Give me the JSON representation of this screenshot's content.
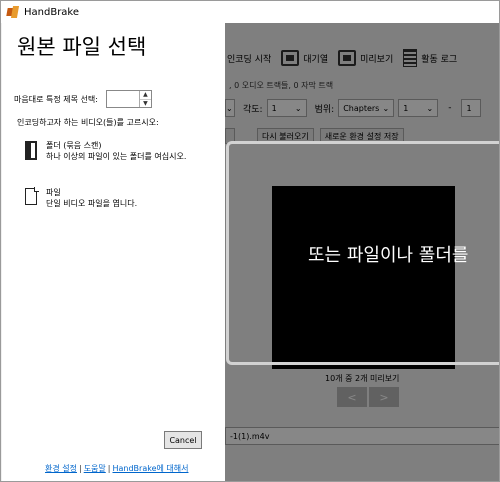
{
  "window": {
    "title": "HandBrake"
  },
  "main": {
    "toolbar": [
      {
        "label": "인코딩 시작",
        "icon": "start-encode-icon"
      },
      {
        "label": "대기열",
        "icon": "queue-icon"
      },
      {
        "label": "미리보기",
        "icon": "preview-icon"
      },
      {
        "label": "활동 로그",
        "icon": "activity-log-icon"
      }
    ],
    "source_info": ", 0 오디오 트랙들, 0 자막 트랙",
    "angle_label": "각도:",
    "angle_value": "1",
    "range_label": "범위:",
    "range_type": "Chapters",
    "range_start": "1",
    "range_sep": "-",
    "range_end": "1",
    "reload_button": "다시 불러오기",
    "save_preset_button": "새로운 환경 설정 저장",
    "preview_count": "10개 중 2개 미리보기",
    "prev_arrow": "<",
    "next_arrow": ">",
    "output_file": "-1(1).m4v"
  },
  "dropzone": {
    "text": "또는 파일이나 폴더를"
  },
  "flyout": {
    "title": "원본 파일 선택",
    "title_select_label": "마음대로 특정 제목 선택:",
    "title_select_value": "",
    "instruction": "인코딩하고자 하는 비디오(들)를 고르시오:",
    "folder_option": {
      "name": "폴더 (묶음 스캔)",
      "description": "하나 이상의 파일이 있는 폴더를 여십시오."
    },
    "file_option": {
      "name": "파일",
      "description": "단일 비디오 파일을 엽니다."
    },
    "cancel_button": "Cancel",
    "links": [
      "환경 설정",
      "도움말",
      "HandBrake에 대해서"
    ],
    "link_separator": "|"
  }
}
